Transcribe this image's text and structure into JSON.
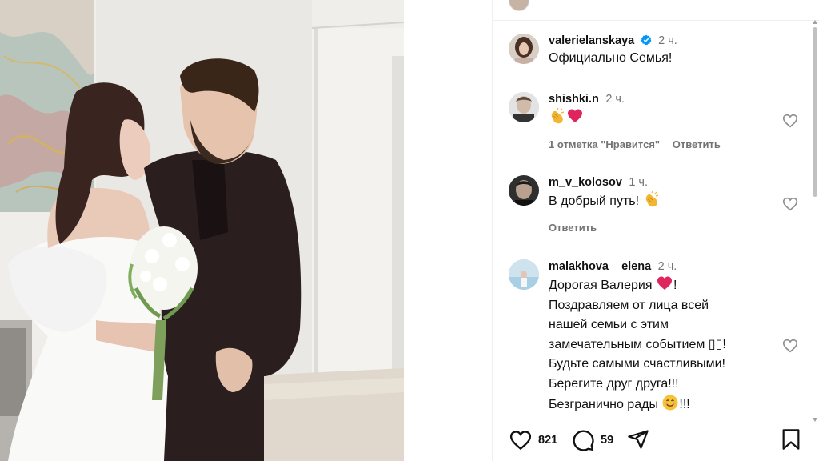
{
  "post": {
    "likes_count": "821",
    "comments_count": "59"
  },
  "comments": [
    {
      "username": "valerielanskaya",
      "verified": true,
      "time": "2 ч.",
      "text_lines": [
        "Официально Семья!"
      ]
    },
    {
      "username": "shishki.n",
      "time": "2 ч.",
      "likes_label": "1 отметка \"Нравится\"",
      "reply_label": "Ответить",
      "emoji": [
        "clapping-hands",
        "red-heart"
      ]
    },
    {
      "username": "m_v_kolosov",
      "time": "1 ч.",
      "text": "В добрый путь!",
      "reply_label": "Ответить",
      "emoji": [
        "clapping-hands"
      ]
    },
    {
      "username": "malakhova__elena",
      "time": "2 ч.",
      "lines": [
        "Дорогая Валерия",
        "Поздравляем от лица всей",
        "нашей семьи с этим",
        "замечательным событием ▯▯!",
        "Будьте самыми счастливыми!",
        "Берегите друг друга!!!",
        "Безгранично рады",
        "!!!"
      ],
      "emoji": [
        "red-heart",
        "smiling-face"
      ]
    }
  ],
  "colors": {
    "verified": "#0095f6",
    "heart": "#e0245e",
    "muted": "#737373",
    "divider": "#efefef"
  },
  "icons": {
    "like": "heart-outline-icon",
    "comment": "speech-bubble-icon",
    "share": "paper-plane-icon",
    "save": "bookmark-icon"
  }
}
